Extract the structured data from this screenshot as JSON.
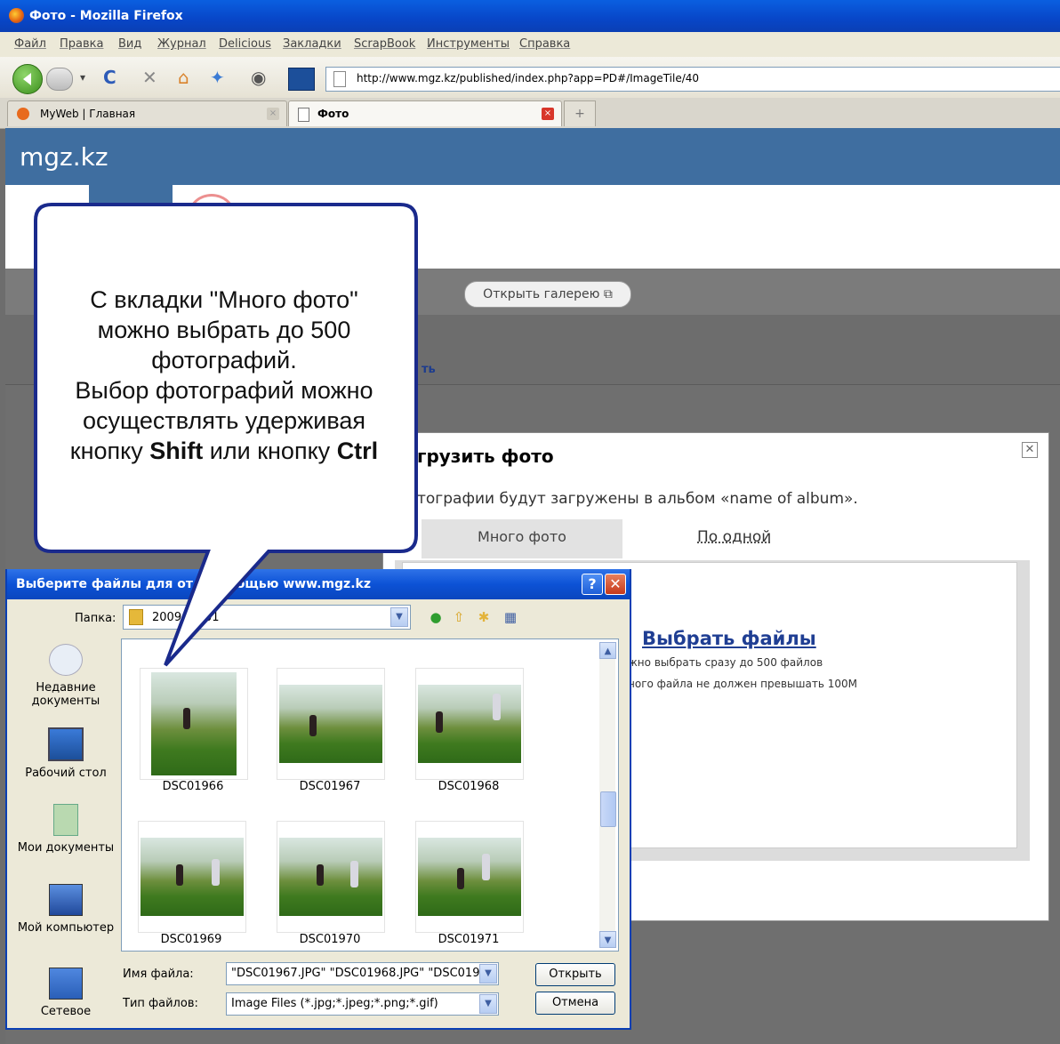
{
  "browser": {
    "window_title": "Фото - Mozilla Firefox",
    "menu": [
      "Файл",
      "Правка",
      "Вид",
      "Журнал",
      "Delicious",
      "Закладки",
      "ScrapBook",
      "Инструменты",
      "Справка"
    ],
    "url": "http://www.mgz.kz/published/index.php?app=PD#/ImageTile/40",
    "tabs": [
      {
        "label": "MyWeb | Главная"
      },
      {
        "label": "Фото"
      }
    ]
  },
  "site": {
    "logo": "mgz.kz",
    "open_gallery": "Открыть галерею ⧉",
    "sub_link_fragment": "ть"
  },
  "upload_dialog": {
    "title_fragment": "грузить фото",
    "info": "тографии будут загружены в альбом «name of album».",
    "tab_multi": "Много фото",
    "tab_single": "По одной",
    "choose_files": "Выбрать файлы",
    "hint1": "жно выбрать сразу до 500 файлов",
    "hint2": "ного файла не должен превышать 100M"
  },
  "file_dialog": {
    "title": "Выберите файлы для от           с помощью www.mgz.kz",
    "folder_label": "Папка:",
    "folder_value": "2009-   -   001",
    "places": [
      "Недавние документы",
      "Рабочий стол",
      "Мои документы",
      "Мой компьютер",
      "Сетевое"
    ],
    "files": [
      "DSC01966",
      "DSC01967",
      "DSC01968",
      "DSC01969",
      "DSC01970",
      "DSC01971"
    ],
    "filename_label": "Имя файла:",
    "filename_value": "\"DSC01967.JPG\" \"DSC01968.JPG\" \"DSC019",
    "filetype_label": "Тип файлов:",
    "filetype_value": "Image Files (*.jpg;*.jpeg;*.png;*.gif)",
    "open_button": "Открыть",
    "cancel_button": "Отмена"
  },
  "callout": {
    "line1": "С вкладки \"Много фото\"",
    "line2": "можно выбрать до 500",
    "line3": "фотографий.",
    "line4": "Выбор фотографий можно",
    "line5": "осуществлять удерживая",
    "line6_pre": "кнопку ",
    "line6_key1": "Shift",
    "line6_mid": " или кнопку ",
    "line6_key2": "Ctrl"
  },
  "colors": {
    "site_header": "#3f6ea0",
    "xp_titlebar": "#0a46be",
    "callout_fill": "#ffffff",
    "callout_border": "#1a2a8c"
  }
}
